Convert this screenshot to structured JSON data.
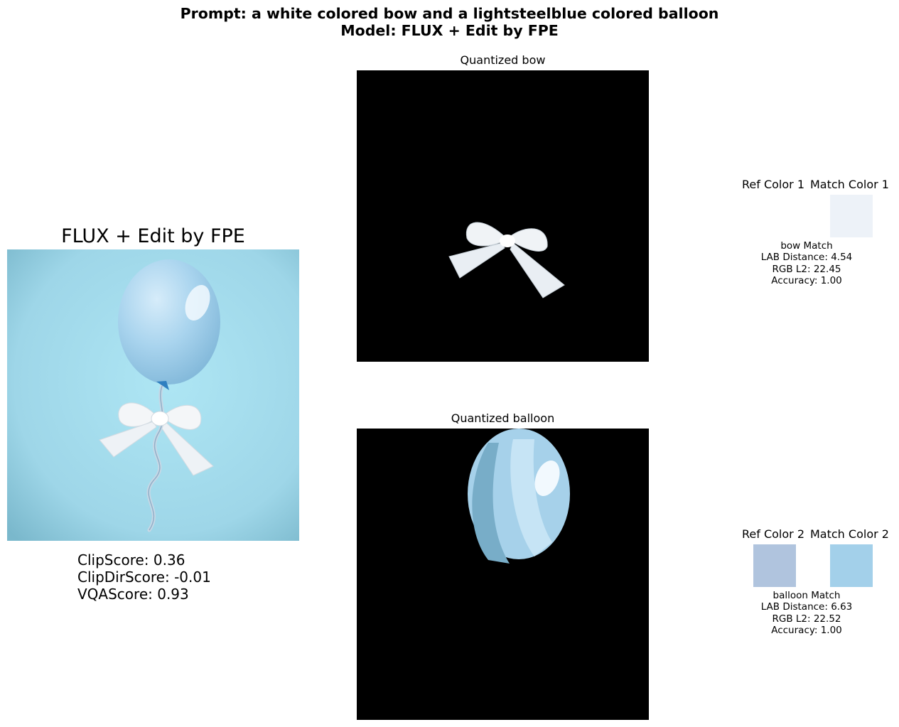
{
  "figure": {
    "title_line1": "Prompt: a white colored bow and a lightsteelblue colored balloon",
    "title_line2": "Model: FLUX + Edit by FPE"
  },
  "generated_image": {
    "title": "FLUX + Edit by FPE",
    "scores": {
      "clip": "ClipScore: 0.36",
      "clip_dir": "ClipDirScore: -0.01",
      "vqa": "VQAScore: 0.93"
    }
  },
  "quantized_panels": [
    {
      "title": "Quantized bow"
    },
    {
      "title": "Quantized balloon"
    }
  ],
  "color_matches": [
    {
      "ref_title": "Ref Color 1",
      "match_title": "Match Color 1",
      "ref_color": "#ffffff",
      "match_color": "#edf2f8",
      "label": "bow Match",
      "lab_distance": "LAB Distance: 4.54",
      "rgb_l2": "RGB L2: 22.45",
      "accuracy": "Accuracy: 1.00"
    },
    {
      "ref_title": "Ref Color 2",
      "match_title": "Match Color 2",
      "ref_color": "#b0c4de",
      "match_color": "#a3d0ea",
      "label": "balloon Match",
      "lab_distance": "LAB Distance: 6.63",
      "rgb_l2": "RGB L2: 22.52",
      "accuracy": "Accuracy: 1.00"
    }
  ],
  "colors": {
    "photo_background": "#a4dbea",
    "balloon_fill": "#a9d4ee",
    "bow_fill": "#f4f6f8",
    "panel_background": "#000000"
  }
}
